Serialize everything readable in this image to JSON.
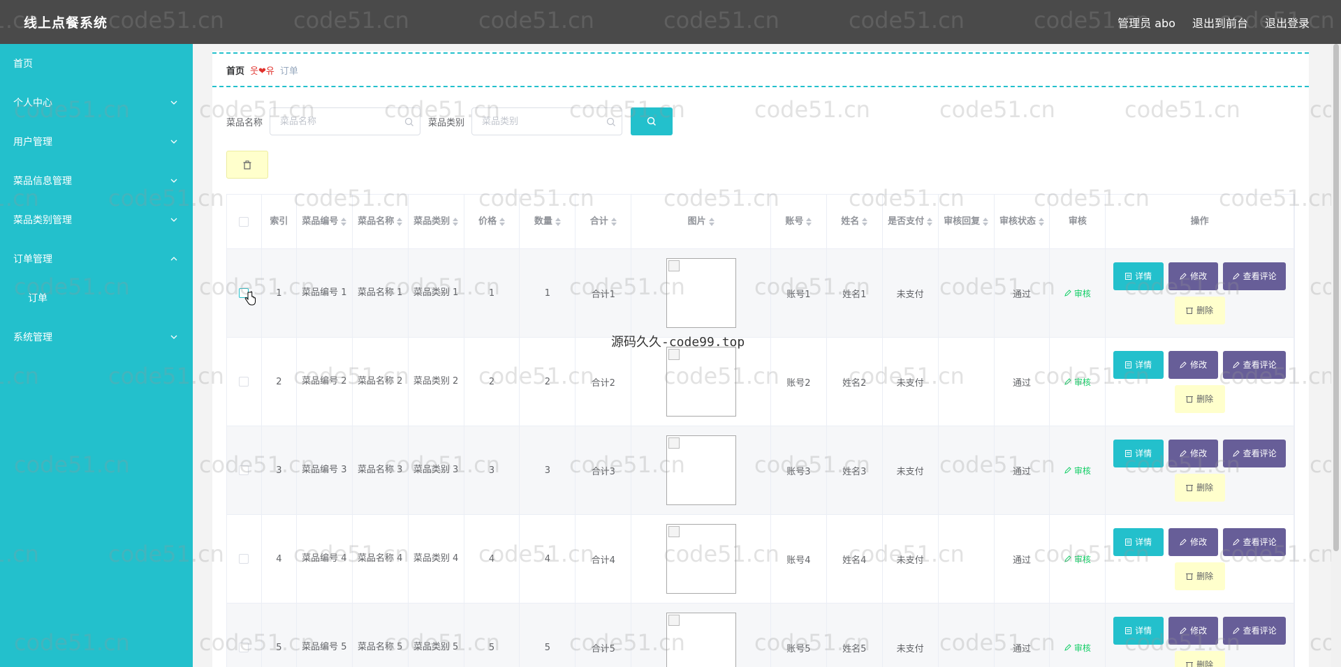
{
  "header": {
    "title": "线上点餐系统",
    "nav": [
      "管理员 abo",
      "退出到前台",
      "退出登录"
    ]
  },
  "sidebar": {
    "items": [
      {
        "label": "首页",
        "arrow": ""
      },
      {
        "label": "个人中心",
        "arrow": "down"
      },
      {
        "label": "用户管理",
        "arrow": "down"
      },
      {
        "label": "菜品信息管理",
        "arrow": "down"
      },
      {
        "label": "菜品类别管理",
        "arrow": "down"
      },
      {
        "label": "订单管理",
        "arrow": "up"
      },
      {
        "label": "订单",
        "arrow": "",
        "sub": true
      },
      {
        "label": "系统管理",
        "arrow": "down"
      }
    ]
  },
  "breadcrumb": {
    "home": "首页",
    "separator": "웃❤유",
    "current": "订单"
  },
  "search": {
    "name_label": "菜品名称",
    "name_placeholder": "菜品名称",
    "type_label": "菜品类别",
    "type_placeholder": "菜品类别"
  },
  "table": {
    "headers": [
      "索引",
      "菜品编号",
      "菜品名称",
      "菜品类别",
      "价格",
      "数量",
      "合计",
      "图片",
      "账号",
      "姓名",
      "是否支付",
      "审核回复",
      "审核状态",
      "审核",
      "操作"
    ],
    "rows": [
      {
        "index": "1",
        "code": "菜品编号 1",
        "name": "菜品名称 1",
        "type": "菜品类别 1",
        "price": "1",
        "qty": "1",
        "total": "合计1",
        "account": "账号1",
        "person": "姓名1",
        "paid": "未支付",
        "reply": "",
        "status": "通过"
      },
      {
        "index": "2",
        "code": "菜品编号 2",
        "name": "菜品名称 2",
        "type": "菜品类别 2",
        "price": "2",
        "qty": "2",
        "total": "合计2",
        "account": "账号2",
        "person": "姓名2",
        "paid": "未支付",
        "reply": "",
        "status": "通过"
      },
      {
        "index": "3",
        "code": "菜品编号 3",
        "name": "菜品名称 3",
        "type": "菜品类别 3",
        "price": "3",
        "qty": "3",
        "total": "合计3",
        "account": "账号3",
        "person": "姓名3",
        "paid": "未支付",
        "reply": "",
        "status": "通过"
      },
      {
        "index": "4",
        "code": "菜品编号 4",
        "name": "菜品名称 4",
        "type": "菜品类别 4",
        "price": "4",
        "qty": "4",
        "total": "合计4",
        "account": "账号4",
        "person": "姓名4",
        "paid": "未支付",
        "reply": "",
        "status": "通过"
      },
      {
        "index": "5",
        "code": "菜品编号 5",
        "name": "菜品名称 5",
        "type": "菜品类别 5",
        "price": "5",
        "qty": "5",
        "total": "合计5",
        "account": "账号5",
        "person": "姓名5",
        "paid": "未支付",
        "reply": "",
        "status": "通过"
      }
    ],
    "audit_label": "审核",
    "actions": {
      "detail": "详情",
      "edit": "修改",
      "review": "查看评论",
      "delete": "删除"
    }
  },
  "watermarks": {
    "repeat": "code51.cn",
    "center": "源码久久-code99.top"
  },
  "colors": {
    "header": "#4a4a4a",
    "sidebar": "#23c0cc",
    "accent": "#23c0cc",
    "purple": "#675e98",
    "delete_bg": "#ffffcc",
    "audit": "#13ce66"
  }
}
